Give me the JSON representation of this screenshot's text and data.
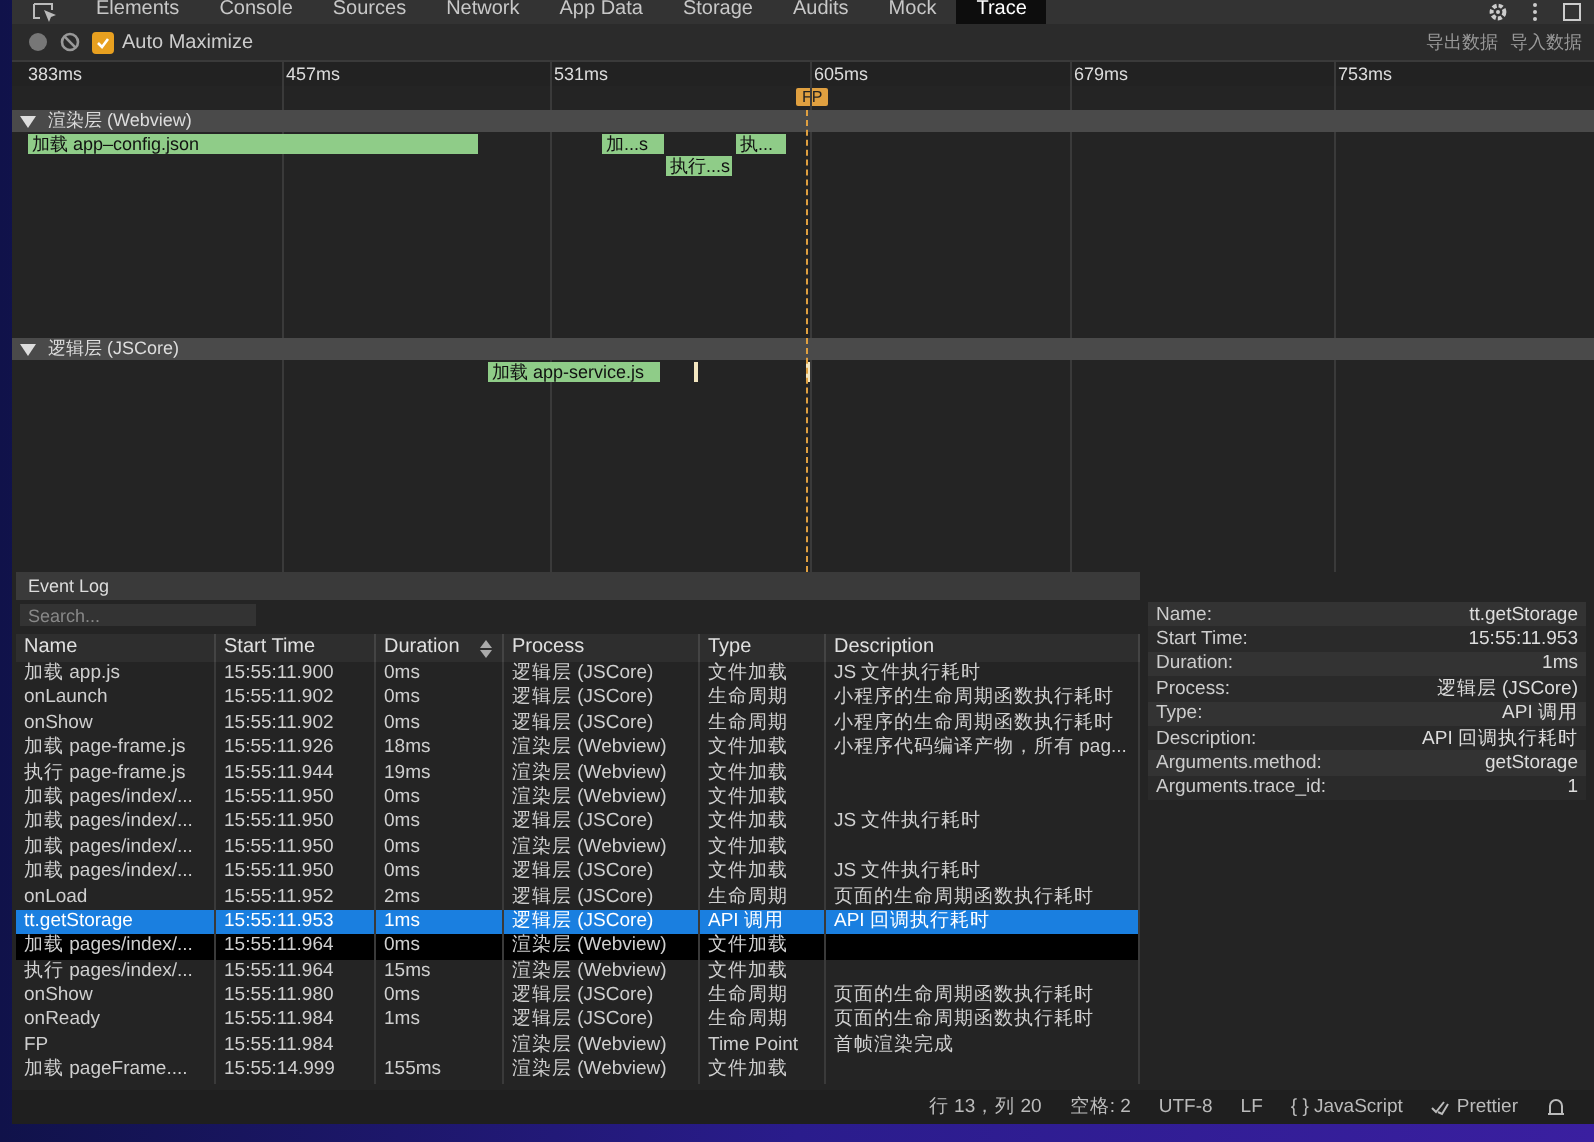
{
  "tabs": [
    {
      "label": "Elements",
      "selected": false
    },
    {
      "label": "Console",
      "selected": false
    },
    {
      "label": "Sources",
      "selected": false
    },
    {
      "label": "Network",
      "selected": false
    },
    {
      "label": "App Data",
      "selected": false
    },
    {
      "label": "Storage",
      "selected": false
    },
    {
      "label": "Audits",
      "selected": false
    },
    {
      "label": "Mock",
      "selected": false
    },
    {
      "label": "Trace",
      "selected": true
    }
  ],
  "toolbar": {
    "auto_maximize": {
      "label": "Auto Maximize",
      "checked": true
    },
    "actions": [
      "导出数据",
      "导入数据"
    ]
  },
  "ruler": [
    "383ms",
    "457ms",
    "531ms",
    "605ms",
    "679ms",
    "753ms"
  ],
  "markers": [
    {
      "label": "FP"
    }
  ],
  "tracks": [
    {
      "label": "渲染层 (Webview)",
      "expanded": true,
      "bars": [
        {
          "label": "加载 app–config.json"
        },
        {
          "label": "加...s"
        },
        {
          "label": "执..."
        },
        {
          "label": "执行...s"
        }
      ]
    },
    {
      "label": "逻辑层 (JSCore)",
      "expanded": true,
      "bars": [
        {
          "label": "加载 app-service.js"
        }
      ]
    }
  ],
  "event_log": {
    "title": "Event Log",
    "search": {
      "placeholder": "Search..."
    },
    "columns": [
      "Name",
      "Start Time",
      "Duration",
      "Process",
      "Type",
      "Description"
    ],
    "rows": [
      {
        "cells": [
          "加载 app.js",
          "15:55:11.900",
          "0ms",
          "逻辑层 (JSCore)",
          "文件加载",
          "JS 文件执行耗时"
        ],
        "selected": false,
        "hovered": false
      },
      {
        "cells": [
          "onLaunch",
          "15:55:11.902",
          "0ms",
          "逻辑层 (JSCore)",
          "生命周期",
          "小程序的生命周期函数执行耗时"
        ],
        "selected": false,
        "hovered": false
      },
      {
        "cells": [
          "onShow",
          "15:55:11.902",
          "0ms",
          "逻辑层 (JSCore)",
          "生命周期",
          "小程序的生命周期函数执行耗时"
        ],
        "selected": false,
        "hovered": false
      },
      {
        "cells": [
          "加载 page-frame.js",
          "15:55:11.926",
          "18ms",
          "渲染层 (Webview)",
          "文件加载",
          "小程序代码编译产物，所有 pag..."
        ],
        "selected": false,
        "hovered": false
      },
      {
        "cells": [
          "执行 page-frame.js",
          "15:55:11.944",
          "19ms",
          "渲染层 (Webview)",
          "文件加载",
          ""
        ],
        "selected": false,
        "hovered": false
      },
      {
        "cells": [
          "加载 pages/index/...",
          "15:55:11.950",
          "0ms",
          "渲染层 (Webview)",
          "文件加载",
          ""
        ],
        "selected": false,
        "hovered": false
      },
      {
        "cells": [
          "加载 pages/index/...",
          "15:55:11.950",
          "0ms",
          "逻辑层 (JSCore)",
          "文件加载",
          "JS 文件执行耗时"
        ],
        "selected": false,
        "hovered": false
      },
      {
        "cells": [
          "加载 pages/index/...",
          "15:55:11.950",
          "0ms",
          "渲染层 (Webview)",
          "文件加载",
          ""
        ],
        "selected": false,
        "hovered": false
      },
      {
        "cells": [
          "加载 pages/index/...",
          "15:55:11.950",
          "0ms",
          "逻辑层 (JSCore)",
          "文件加载",
          "JS 文件执行耗时"
        ],
        "selected": false,
        "hovered": false
      },
      {
        "cells": [
          "onLoad",
          "15:55:11.952",
          "2ms",
          "逻辑层 (JSCore)",
          "生命周期",
          "页面的生命周期函数执行耗时"
        ],
        "selected": false,
        "hovered": false
      },
      {
        "cells": [
          "tt.getStorage",
          "15:55:11.953",
          "1ms",
          "逻辑层 (JSCore)",
          "API 调用",
          "API 回调执行耗时"
        ],
        "selected": true,
        "hovered": false
      },
      {
        "cells": [
          "加载 pages/index/...",
          "15:55:11.964",
          "0ms",
          "渲染层 (Webview)",
          "文件加载",
          ""
        ],
        "selected": false,
        "hovered": true
      },
      {
        "cells": [
          "执行 pages/index/...",
          "15:55:11.964",
          "15ms",
          "渲染层 (Webview)",
          "文件加载",
          ""
        ],
        "selected": false,
        "hovered": false
      },
      {
        "cells": [
          "onShow",
          "15:55:11.980",
          "0ms",
          "逻辑层 (JSCore)",
          "生命周期",
          "页面的生命周期函数执行耗时"
        ],
        "selected": false,
        "hovered": false
      },
      {
        "cells": [
          "onReady",
          "15:55:11.984",
          "1ms",
          "逻辑层 (JSCore)",
          "生命周期",
          "页面的生命周期函数执行耗时"
        ],
        "selected": false,
        "hovered": false
      },
      {
        "cells": [
          "FP",
          "15:55:11.984",
          "",
          "渲染层 (Webview)",
          "Time Point",
          "首帧渲染完成"
        ],
        "selected": false,
        "hovered": false
      },
      {
        "cells": [
          "加载 pageFrame....",
          "15:55:14.999",
          "155ms",
          "渲染层 (Webview)",
          "文件加载",
          ""
        ],
        "selected": false,
        "hovered": false
      }
    ]
  },
  "details": [
    {
      "key": "Name:",
      "value": "tt.getStorage"
    },
    {
      "key": "Start Time:",
      "value": "15:55:11.953"
    },
    {
      "key": "Duration:",
      "value": "1ms"
    },
    {
      "key": "Process:",
      "value": "逻辑层 (JSCore)"
    },
    {
      "key": "Type:",
      "value": "API 调用"
    },
    {
      "key": "Description:",
      "value": "API 回调执行耗时"
    },
    {
      "key": "Arguments.method:",
      "value": "getStorage"
    },
    {
      "key": "Arguments.trace_id:",
      "value": "1"
    }
  ],
  "status_bar": {
    "position": "行 13，列 20",
    "indent": "空格: 2",
    "encoding": "UTF-8",
    "eol": "LF",
    "language": "{ } JavaScript",
    "formatter": "Prettier"
  }
}
